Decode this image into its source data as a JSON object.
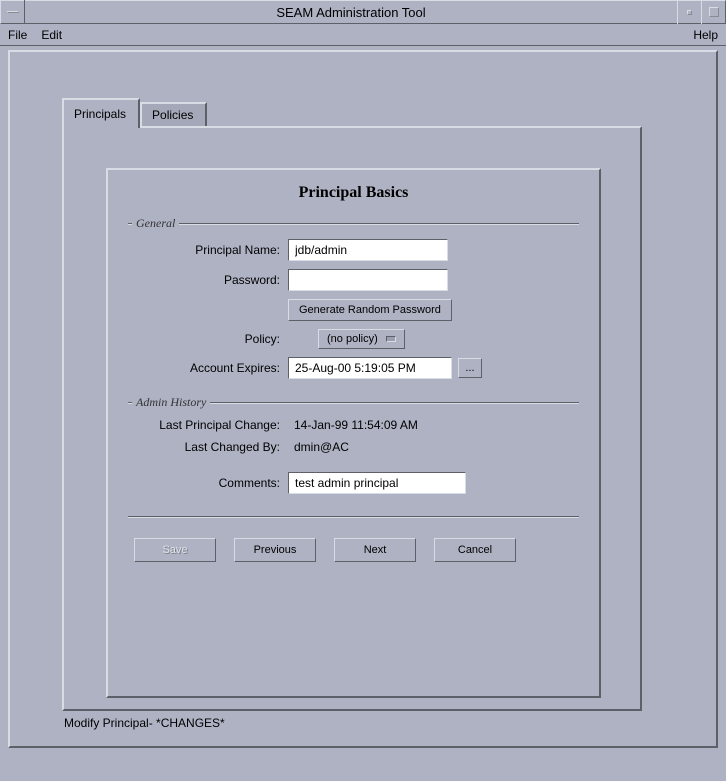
{
  "window": {
    "title": "SEAM Administration Tool"
  },
  "menubar": {
    "file": "File",
    "edit": "Edit",
    "help": "Help"
  },
  "tabs": {
    "principals": "Principals",
    "policies": "Policies"
  },
  "panel": {
    "heading": "Principal Basics",
    "groups": {
      "general": "General",
      "history": "Admin History"
    },
    "labels": {
      "principal_name": "Principal Name:",
      "password": "Password:",
      "policy": "Policy:",
      "account_expires": "Account Expires:",
      "last_change": "Last Principal Change:",
      "last_by": "Last Changed By:",
      "comments": "Comments:"
    },
    "values": {
      "principal_name": "jdb/admin",
      "password": "",
      "policy_selected": "(no policy)",
      "account_expires": "25-Aug-00 5:19:05 PM",
      "last_change": "14-Jan-99 11:54:09 AM",
      "last_by": "dmin@AC",
      "comments": "test admin principal"
    },
    "buttons": {
      "gen_password": "Generate Random Password",
      "dots": "...",
      "save": "Save",
      "previous": "Previous",
      "next": "Next",
      "cancel": "Cancel"
    }
  },
  "status": "Modify Principal- *CHANGES*"
}
